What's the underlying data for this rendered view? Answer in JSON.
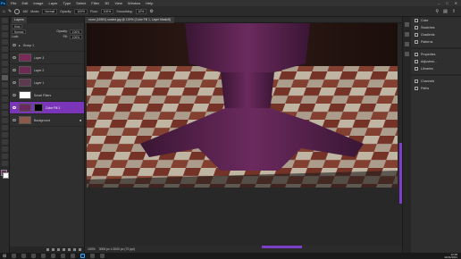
{
  "app": {
    "logo": "Ps"
  },
  "menu": [
    "File",
    "Edit",
    "Image",
    "Layer",
    "Type",
    "Select",
    "Filter",
    "3D",
    "View",
    "Window",
    "Help"
  ],
  "options": {
    "brush_size": "160",
    "mode_label": "Mode:",
    "mode": "Normal",
    "opacity_label": "Opacity:",
    "opacity": "100%",
    "flow_label": "Flow:",
    "flow": "100%",
    "smoothing_label": "Smoothing:",
    "smoothing": "10%"
  },
  "layers_panel": {
    "tab": "Layers",
    "kind": "Kind",
    "blend": "Normal",
    "opacity_label": "Opacity:",
    "opacity": "100%",
    "fill_label": "Fill:",
    "fill": "100%",
    "lock_label": "Lock:",
    "layers": [
      {
        "name": "Group 1",
        "selected": false
      },
      {
        "name": "Layer 3",
        "selected": false
      },
      {
        "name": "Layer 2",
        "selected": false
      },
      {
        "name": "Layer 1",
        "selected": false
      },
      {
        "name": "Smart Filters",
        "selected": false
      },
      {
        "name": "Color Fill 1",
        "selected": true
      },
      {
        "name": "Background",
        "selected": false
      }
    ]
  },
  "document": {
    "tab_title": "room (16591) scaled.jpg @ 100% (Color Fill 1, Layer Mask/8)"
  },
  "status": {
    "zoom": "100%",
    "dims": "3000 px x 2000 px (72 ppi)"
  },
  "right_panels": [
    {
      "label": "Color",
      "icon": "color-icon"
    },
    {
      "label": "Swatches",
      "icon": "swatches-icon"
    },
    {
      "label": "Gradients",
      "icon": "gradients-icon"
    },
    {
      "label": "Patterns",
      "icon": "patterns-icon"
    },
    {
      "label": "Properties",
      "icon": "properties-icon"
    },
    {
      "label": "Adjustme...",
      "icon": "adjustments-icon"
    },
    {
      "label": "Libraries",
      "icon": "libraries-icon"
    },
    {
      "label": "Channels",
      "icon": "channels-icon"
    },
    {
      "label": "Paths",
      "icon": "paths-icon"
    }
  ],
  "taskbar": {
    "time": "12:28",
    "date": "11/01/2021"
  },
  "colors": {
    "accent": "#7d3fc8",
    "foreground": "#6b2a5e",
    "background": "#ffffff"
  }
}
